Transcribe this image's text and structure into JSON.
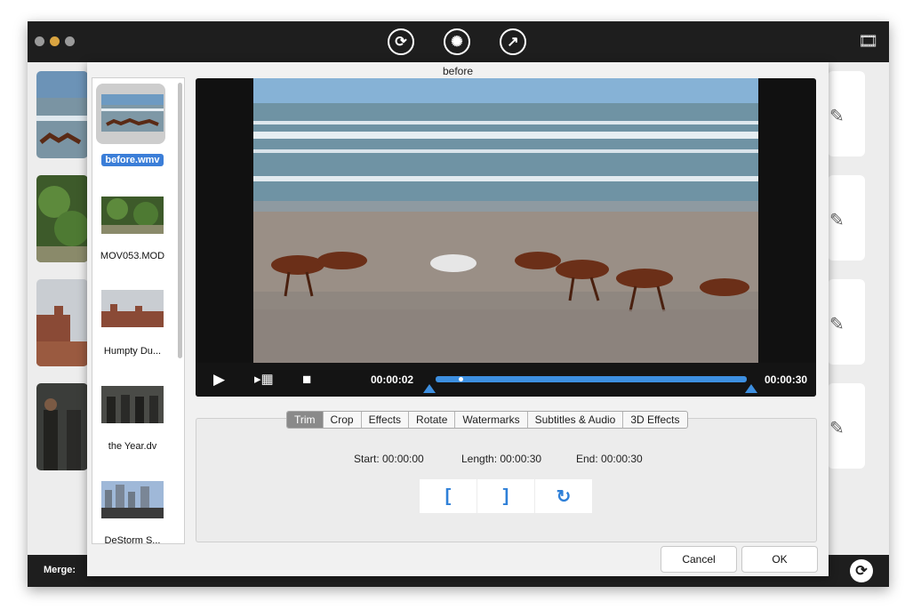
{
  "toolbar": {
    "icons": [
      "convert-icon",
      "film-reel-icon",
      "share-icon"
    ],
    "right_icon": "media-browser-icon"
  },
  "bottom_bar": {
    "merge_label": "Merge:"
  },
  "dialog": {
    "title": "before",
    "files": [
      {
        "name": "before.wmv",
        "selected": true
      },
      {
        "name": "MOV053.MOD",
        "selected": false
      },
      {
        "name": "Humpty Du...",
        "selected": false
      },
      {
        "name": "the Year.dv",
        "selected": false
      },
      {
        "name": "DeStorm S...",
        "selected": false
      }
    ],
    "player": {
      "current_time": "00:00:02",
      "total_time": "00:00:30",
      "progress_fraction": 0.067
    },
    "tabs": [
      "Trim",
      "Crop",
      "Effects",
      "Rotate",
      "Watermarks",
      "Subtitles & Audio",
      "3D Effects"
    ],
    "active_tab": "Trim",
    "trim": {
      "start": "Start: 00:00:00",
      "length": "Length: 00:00:30",
      "end": "End: 00:00:30"
    },
    "buttons": {
      "cancel": "Cancel",
      "ok": "OK"
    }
  },
  "colors": {
    "accent": "#3d8fe0",
    "titlebar": "#1e1e1e",
    "selection": "#3b7ed8"
  }
}
